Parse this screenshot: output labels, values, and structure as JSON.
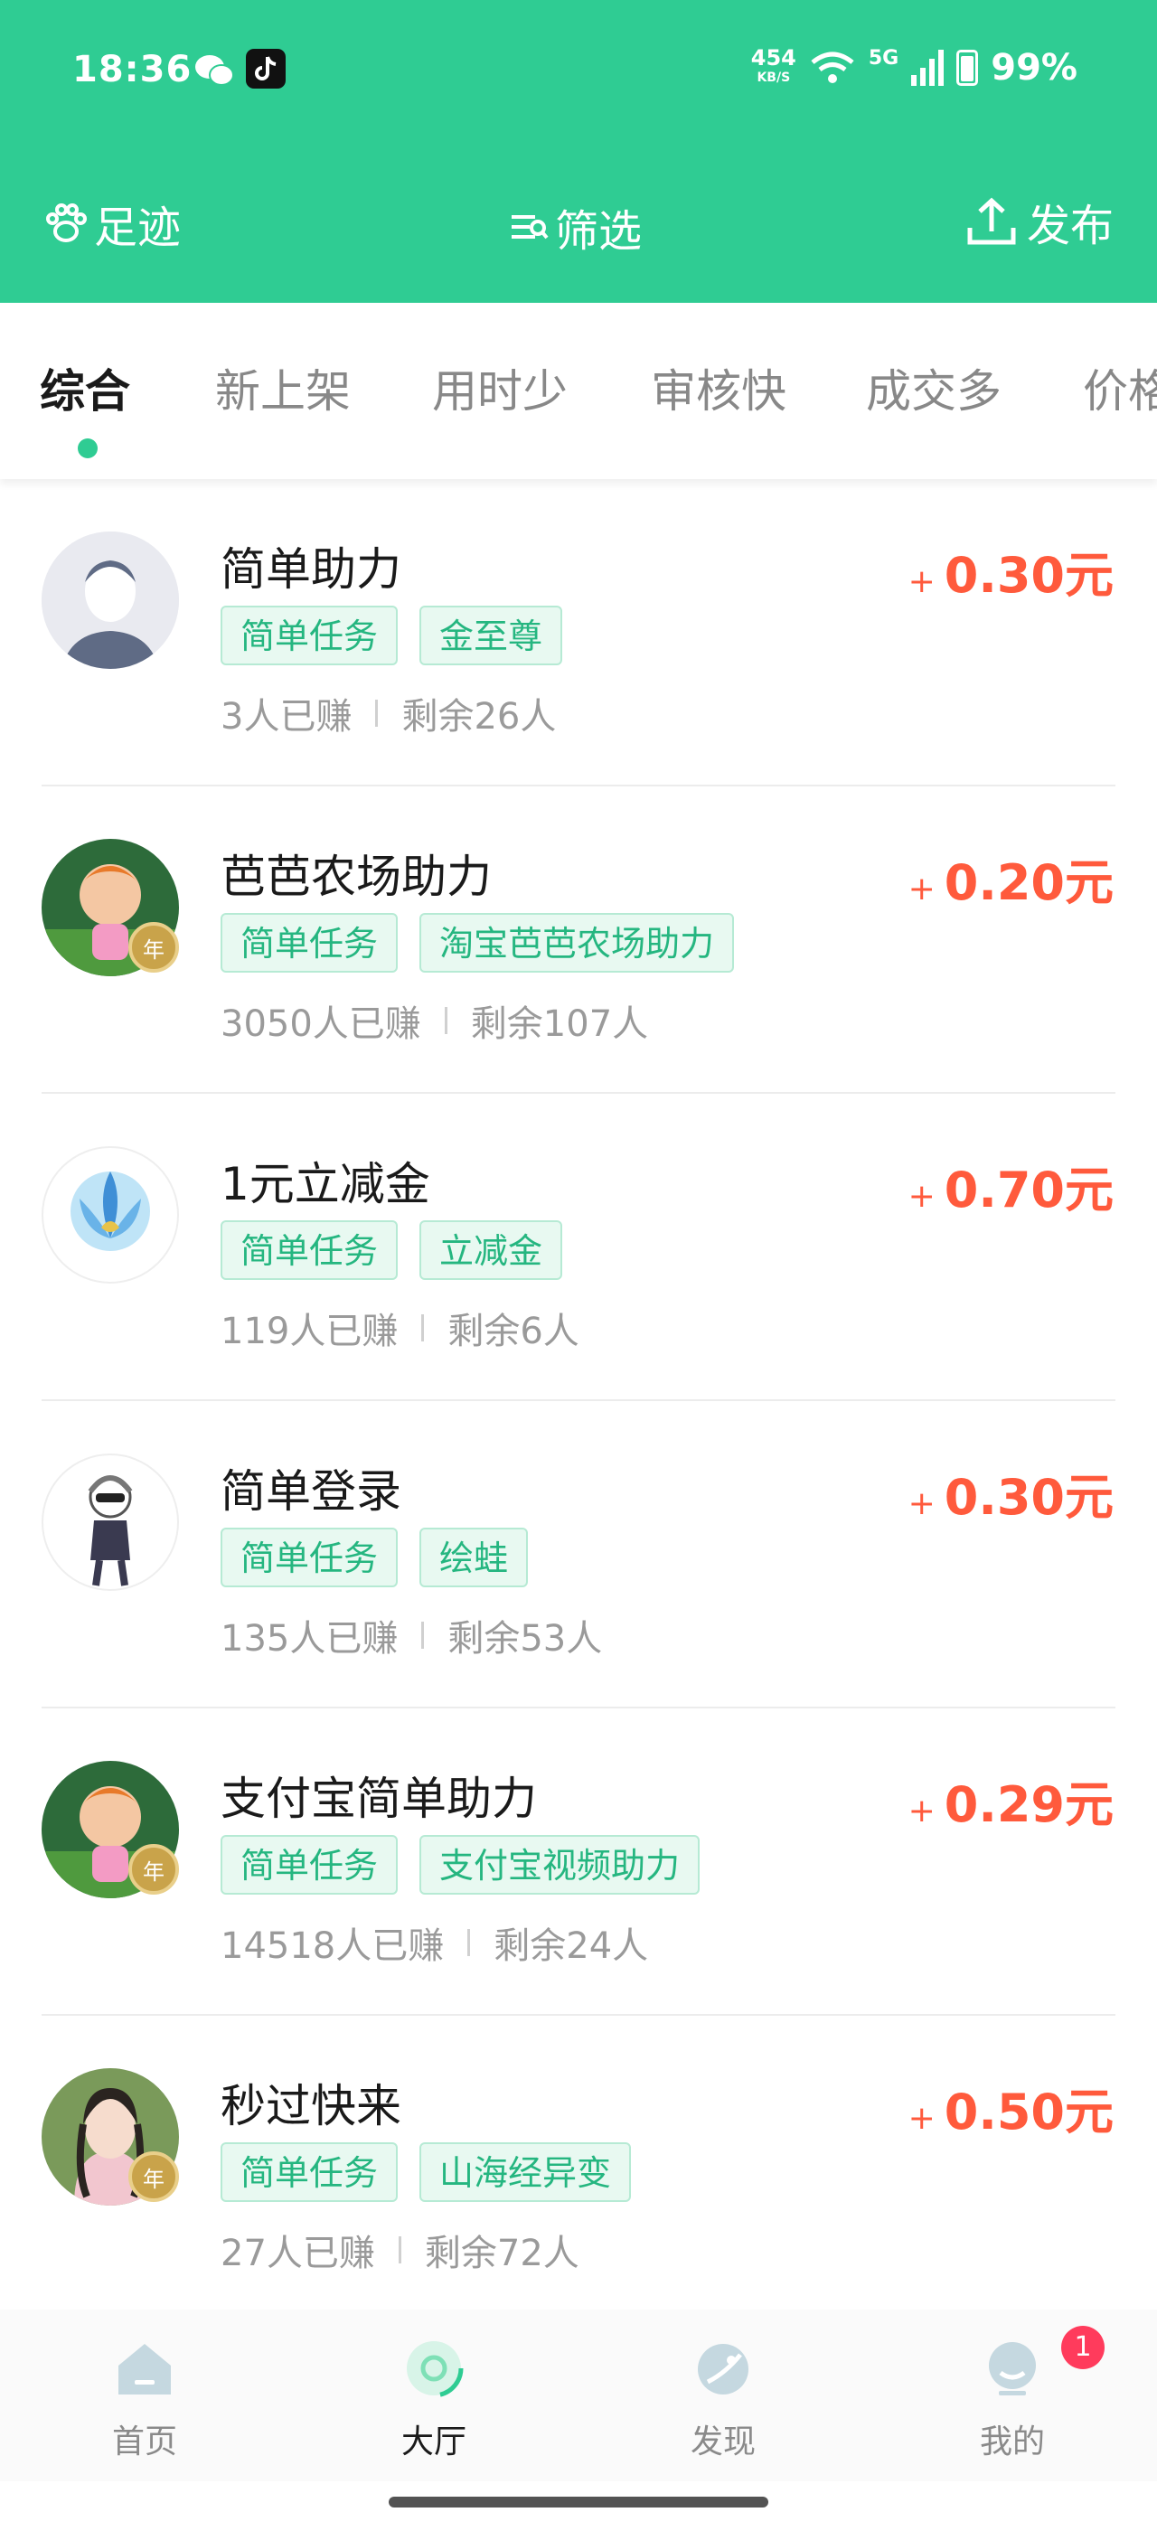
{
  "status_bar": {
    "time": "18:36",
    "net_speed": "454",
    "net_unit": "KB/S",
    "signal": "5G",
    "battery": "99%"
  },
  "header": {
    "left_label": "足迹",
    "center_label": "筛选",
    "right_label": "发布",
    "bg_color": "#2fcc93"
  },
  "tabs": [
    "综合",
    "新上架",
    "用时少",
    "审核快",
    "成交多",
    "价格"
  ],
  "active_tab": 0,
  "tasks": [
    {
      "title": "简单助力",
      "tags": [
        "简单任务",
        "金至尊"
      ],
      "earned": "3人已赚",
      "remaining": "剩余26人",
      "price": "0.30元",
      "avatar": "default-avatar",
      "badge": false
    },
    {
      "title": "芭芭农场助力",
      "tags": [
        "简单任务",
        "淘宝芭芭农场助力"
      ],
      "earned": "3050人已赚",
      "remaining": "剩余107人",
      "price": "0.20元",
      "avatar": "cartoon-avatar",
      "badge": true
    },
    {
      "title": "1元立减金",
      "tags": [
        "简单任务",
        "立减金"
      ],
      "earned": "119人已赚",
      "remaining": "剩余6人",
      "price": "0.70元",
      "avatar": "emblem-avatar",
      "badge": false
    },
    {
      "title": "简单登录",
      "tags": [
        "简单任务",
        "绘蛙"
      ],
      "earned": "135人已赚",
      "remaining": "剩余53人",
      "price": "0.30元",
      "avatar": "sketch-avatar",
      "badge": false
    },
    {
      "title": "支付宝简单助力",
      "tags": [
        "简单任务",
        "支付宝视频助力"
      ],
      "earned": "14518人已赚",
      "remaining": "剩余24人",
      "price": "0.29元",
      "avatar": "cartoon-avatar",
      "badge": true
    },
    {
      "title": "秒过快来",
      "tags": [
        "简单任务",
        "山海经异变"
      ],
      "earned": "27人已赚",
      "remaining": "剩余72人",
      "price": "0.50元",
      "avatar": "photo-avatar",
      "badge": true
    }
  ],
  "price_prefix": "+",
  "badge_text": "年",
  "bottom_nav": [
    {
      "label": "首页",
      "icon": "home-icon"
    },
    {
      "label": "大厅",
      "icon": "hall-icon"
    },
    {
      "label": "发现",
      "icon": "discover-icon"
    },
    {
      "label": "我的",
      "icon": "profile-icon"
    }
  ],
  "active_nav": 1,
  "notification_count": "1",
  "colors": {
    "accent": "#2fcc93",
    "price": "#ff5a3c",
    "tag_text": "#25b680"
  }
}
